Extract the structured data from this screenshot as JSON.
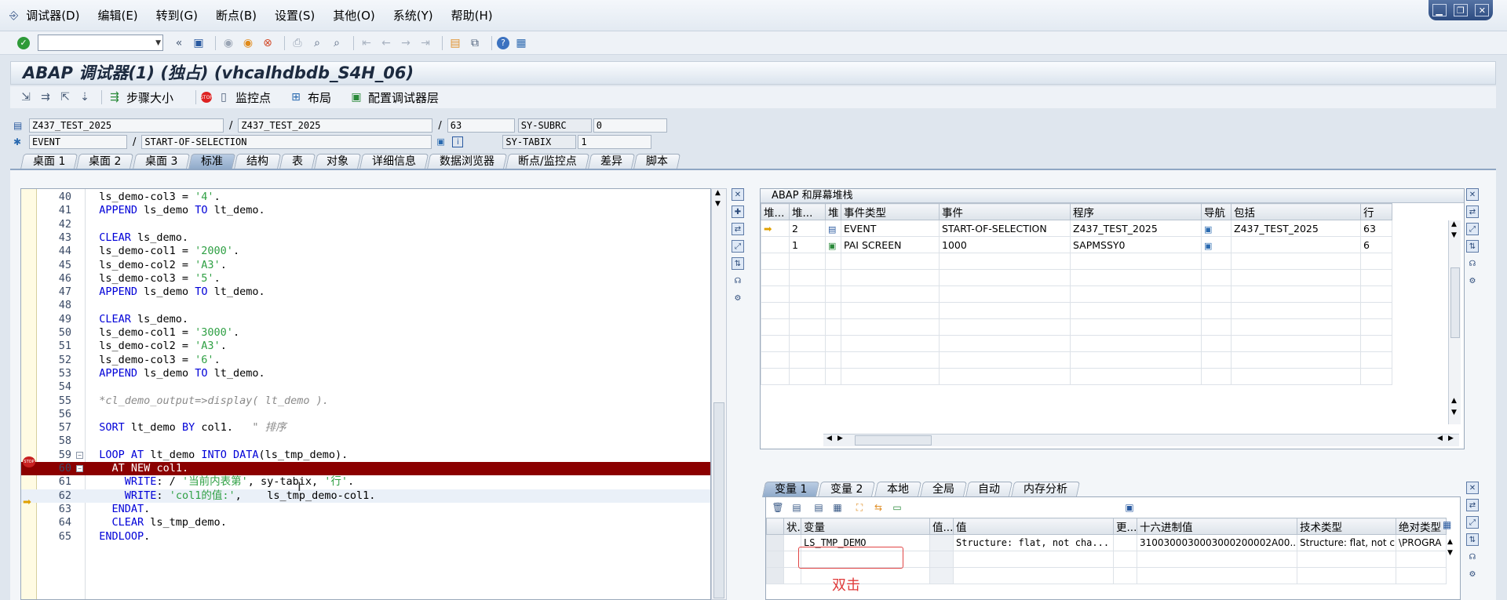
{
  "menubar": {
    "items": [
      "调试器(D)",
      "编辑(E)",
      "转到(G)",
      "断点(B)",
      "设置(S)",
      "其他(O)",
      "系统(Y)",
      "帮助(H)"
    ]
  },
  "window_controls": [
    "minimize-icon",
    "restore-icon",
    "close-icon"
  ],
  "toolbar": {
    "command_value": ""
  },
  "title": "ABAP 调试器(1) (独占) (vhcalhdbdb_S4H_06)",
  "app_toolbar": {
    "step_size": "步骤大小",
    "watchpoint": "监控点",
    "layout": "布局",
    "config_layer": "配置调试器层"
  },
  "info": {
    "row1": {
      "program": "Z437_TEST_2025",
      "include": "Z437_TEST_2025",
      "line": "63",
      "sysfield": "SY-SUBRC",
      "sysvalue": "0"
    },
    "row2": {
      "event_type": "EVENT",
      "event": "START-OF-SELECTION",
      "sysfield": "SY-TABIX",
      "sysvalue": "1"
    }
  },
  "tabs": [
    "桌面 1",
    "桌面 2",
    "桌面 3",
    "标准",
    "结构",
    "表",
    "对象",
    "详细信息",
    "数据浏览器",
    "断点/监控点",
    "差异",
    "脚本"
  ],
  "active_tab": "标准",
  "code": {
    "lines": [
      {
        "n": "40",
        "t": "  ls_demo-col3 = '4'."
      },
      {
        "n": "41",
        "t": "  APPEND ls_demo TO lt_demo."
      },
      {
        "n": "42",
        "t": ""
      },
      {
        "n": "43",
        "t": "  CLEAR ls_demo."
      },
      {
        "n": "44",
        "t": "  ls_demo-col1 = '2000'."
      },
      {
        "n": "45",
        "t": "  ls_demo-col2 = 'A3'."
      },
      {
        "n": "46",
        "t": "  ls_demo-col3 = '5'."
      },
      {
        "n": "47",
        "t": "  APPEND ls_demo TO lt_demo."
      },
      {
        "n": "48",
        "t": ""
      },
      {
        "n": "49",
        "t": "  CLEAR ls_demo."
      },
      {
        "n": "50",
        "t": "  ls_demo-col1 = '3000'."
      },
      {
        "n": "51",
        "t": "  ls_demo-col2 = 'A3'."
      },
      {
        "n": "52",
        "t": "  ls_demo-col3 = '6'."
      },
      {
        "n": "53",
        "t": "  APPEND ls_demo TO lt_demo."
      },
      {
        "n": "54",
        "t": ""
      },
      {
        "n": "55",
        "t": "  *cl_demo_output=>display( lt_demo )."
      },
      {
        "n": "56",
        "t": ""
      },
      {
        "n": "57",
        "t": "  SORT lt_demo BY col1.   \" 排序"
      },
      {
        "n": "58",
        "t": ""
      },
      {
        "n": "59",
        "t": "  LOOP AT lt_demo INTO DATA(ls_tmp_demo)."
      },
      {
        "n": "60",
        "t": "    AT NEW col1."
      },
      {
        "n": "61",
        "t": "      WRITE: / '当前内表第', sy-tabix, '行'."
      },
      {
        "n": "62",
        "t": "      WRITE: 'col1的值:',    ls_tmp_demo-col1."
      },
      {
        "n": "63",
        "t": "    ENDAT."
      },
      {
        "n": "64",
        "t": "    CLEAR ls_tmp_demo."
      },
      {
        "n": "65",
        "t": "  ENDLOOP."
      }
    ]
  },
  "stack": {
    "title": "ABAP 和屏幕堆栈",
    "columns": [
      "堆...",
      "堆...",
      "堆",
      "事件类型",
      "事件",
      "程序",
      "导航",
      "包括",
      "行"
    ],
    "rows": [
      {
        "level": "2",
        "type": "EVENT",
        "event": "START-OF-SELECTION",
        "program": "Z437_TEST_2025",
        "include": "Z437_TEST_2025",
        "line": "63"
      },
      {
        "level": "1",
        "type": "PAI SCREEN",
        "event": "1000",
        "program": "SAPMSSY0",
        "include": "",
        "line": "6"
      }
    ]
  },
  "var_tabs": [
    "变量 1",
    "变量 2",
    "本地",
    "全局",
    "自动",
    "内存分析"
  ],
  "active_var_tab": "变量 1",
  "vars": {
    "columns": [
      "状...",
      "变量",
      "值...",
      "值",
      "更...",
      "十六进制值",
      "技术类型",
      "绝对类型"
    ],
    "rows": [
      {
        "name": "LS_TMP_DEMO",
        "value": "Structure: flat, not cha...",
        "hex": "3100300030003000200002A00...",
        "tech": "Structure: flat, not c...",
        "abs": "\\PROGRA"
      }
    ]
  },
  "annotation": "双击",
  "colors": {
    "breakpoint_line": "#8b0000",
    "annotation": "#e03a3a"
  }
}
